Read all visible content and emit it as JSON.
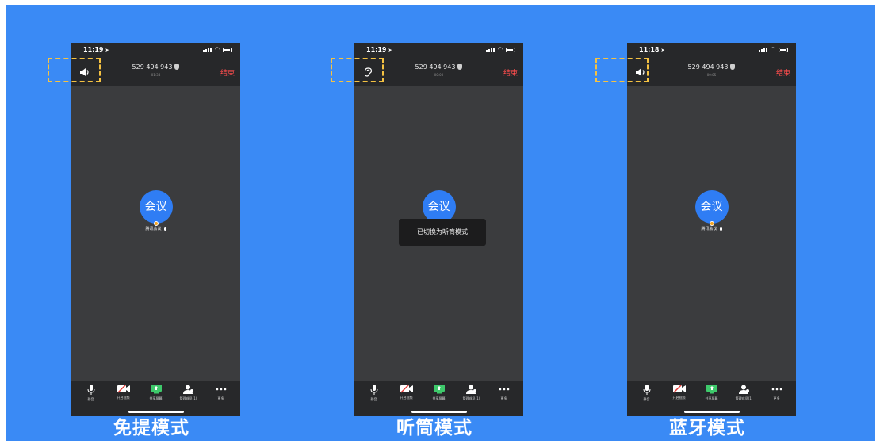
{
  "colors": {
    "background": "#3a8af5",
    "phone_bg": "#3b3c3e",
    "bar_bg": "#27282a",
    "end": "#ff4d4d",
    "avatar": "#2f7df4",
    "highlight": "#f5c242"
  },
  "phones": [
    {
      "time": "11:19",
      "audio_icon": "speaker-icon",
      "meeting_id": "529 494 943",
      "duration": "01:34",
      "end_label": "结束",
      "avatar_text": "会议",
      "participant_name": "腾讯会议",
      "caption": "免提模式"
    },
    {
      "time": "11:19",
      "audio_icon": "ear-icon",
      "meeting_id": "529 494 943",
      "duration": "00:00",
      "end_label": "结束",
      "avatar_text": "会议",
      "toast": "已切换为听筒模式",
      "caption": "听筒模式"
    },
    {
      "time": "11:18",
      "audio_icon": "speaker-icon",
      "meeting_id": "529 494 943",
      "duration": "00:05",
      "end_label": "结束",
      "avatar_text": "会议",
      "participant_name": "腾讯会议",
      "caption": "蓝牙模式"
    }
  ],
  "toolbar": [
    {
      "icon": "microphone-icon",
      "label": "静音"
    },
    {
      "icon": "video-off-icon",
      "label": "开启视频"
    },
    {
      "icon": "share-screen-icon",
      "label": "共享屏幕"
    },
    {
      "icon": "participants-icon",
      "label": "管理成员(1)"
    },
    {
      "icon": "more-icon",
      "label": "更多"
    }
  ]
}
